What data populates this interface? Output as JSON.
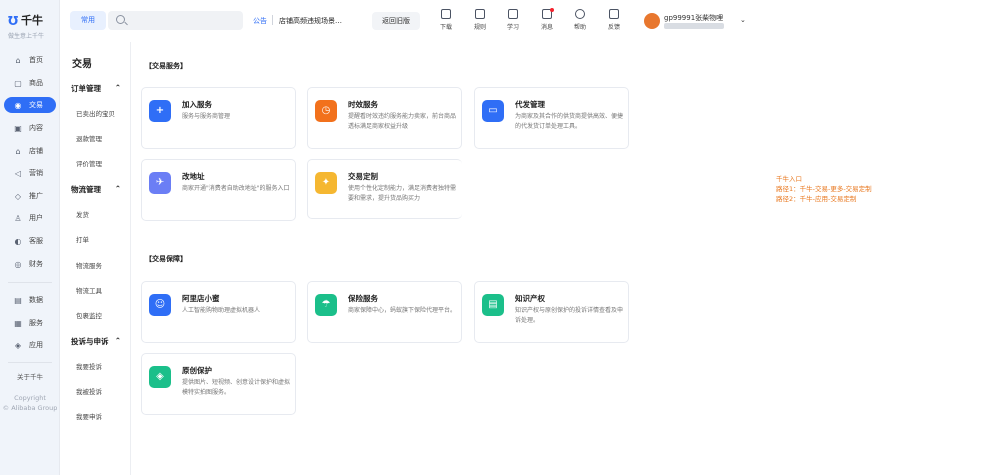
{
  "app": {
    "name": "千牛",
    "slogan": "做生意上千牛"
  },
  "sidebar": {
    "items": [
      {
        "label": "首页",
        "icon": "home-icon",
        "glyph": "⌂"
      },
      {
        "label": "商品",
        "icon": "goods-icon",
        "glyph": "▢"
      },
      {
        "label": "交易",
        "icon": "trade-icon",
        "glyph": "◉"
      },
      {
        "label": "内容",
        "icon": "content-icon",
        "glyph": "▣"
      },
      {
        "label": "店铺",
        "icon": "shop-icon",
        "glyph": "⌂"
      },
      {
        "label": "营销",
        "icon": "marketing-icon",
        "glyph": "◁"
      },
      {
        "label": "推广",
        "icon": "promote-icon",
        "glyph": "◇"
      },
      {
        "label": "用户",
        "icon": "user-icon",
        "glyph": "♙"
      },
      {
        "label": "客服",
        "icon": "service-icon",
        "glyph": "◐"
      },
      {
        "label": "财务",
        "icon": "finance-icon",
        "glyph": "◎"
      },
      {
        "label": "数据",
        "icon": "data-icon",
        "glyph": "▤"
      },
      {
        "label": "服务",
        "icon": "services-icon",
        "glyph": "▦"
      },
      {
        "label": "应用",
        "icon": "apps-icon",
        "glyph": "◈"
      }
    ],
    "about": "关于千牛",
    "copyright_1": "Copyright",
    "copyright_2": "© Alibaba Group"
  },
  "topbar": {
    "common_label": "常用",
    "search_placeholder": "",
    "notice_tag": "公告",
    "notice_text": "店铺高频违规场景…",
    "old_version_label": "返回旧版",
    "tools": [
      {
        "label": "下载",
        "icon": "download-icon"
      },
      {
        "label": "规则",
        "icon": "rules-icon"
      },
      {
        "label": "学习",
        "icon": "learn-icon"
      },
      {
        "label": "消息",
        "icon": "message-icon"
      },
      {
        "label": "帮助",
        "icon": "help-icon"
      },
      {
        "label": "反馈",
        "icon": "feedback-icon"
      }
    ],
    "user_name": "gp99991张柴物哩"
  },
  "submenu": {
    "title": "交易",
    "groups": [
      {
        "label": "订单管理",
        "items": [
          "已卖出的宝贝",
          "退款管理",
          "评价管理"
        ]
      },
      {
        "label": "物流管理",
        "items": [
          "发货",
          "打单",
          "物流服务",
          "物流工具",
          "包裹监控"
        ]
      },
      {
        "label": "投诉与申诉",
        "items": [
          "我要投诉",
          "我被投诉",
          "我要申诉"
        ]
      }
    ]
  },
  "main": {
    "section1_title": "【交易服务】",
    "section2_title": "【交易保障】",
    "cards": [
      {
        "title": "加入服务",
        "desc": "服务与服务商管理",
        "icon": "plus-circle-icon",
        "glyph": "+",
        "color": "#2f6ef6"
      },
      {
        "title": "时效服务",
        "desc": "提醒看时效违约服务能力卖家，前台商品透标满足商家权益升级",
        "icon": "clock-icon",
        "glyph": "◷",
        "color": "#f2711c"
      },
      {
        "title": "代发管理",
        "desc": "为商家及其合作的供货商提供高效、便捷的代发货订单处理工具。",
        "icon": "box-icon",
        "glyph": "▭",
        "color": "#2f6ef6"
      },
      {
        "title": "改地址",
        "desc": "商家开通\"消费者自助改地址\"的服务入口",
        "icon": "plane-icon",
        "glyph": "✈",
        "color": "#6b7ef5"
      },
      {
        "title": "交易定制",
        "desc": "使用个性化定制能力，满足消费者独特需要和需求，提升货品购买力",
        "icon": "custom-icon",
        "glyph": "✦",
        "color": "#f5b731"
      },
      {
        "title": "阿里店小蜜",
        "desc": "人工智能购物助理虚拟机器人",
        "icon": "bot-icon",
        "glyph": "☺",
        "color": "#2f6ef6"
      },
      {
        "title": "保险服务",
        "desc": "商家保障中心，蚂蚁旗下保险代理平台。",
        "icon": "umbrella-icon",
        "glyph": "☂",
        "color": "#1bbf8a"
      },
      {
        "title": "知识产权",
        "desc": "知识产权与原创保护的投诉详情查看及申诉处理。",
        "icon": "document-icon",
        "glyph": "▤",
        "color": "#1bbf8a"
      },
      {
        "title": "原创保护",
        "desc": "提供图片、短视频、创意设计保护和虚拟模特实拍图服务。",
        "icon": "shield-icon",
        "glyph": "◈",
        "color": "#1bbf8a"
      }
    ]
  },
  "annotation": {
    "line1": "千牛入口",
    "line2": "路径1：千牛-交易-更多-交易定制",
    "line3": "路径2：千牛-应用-交易定制"
  }
}
